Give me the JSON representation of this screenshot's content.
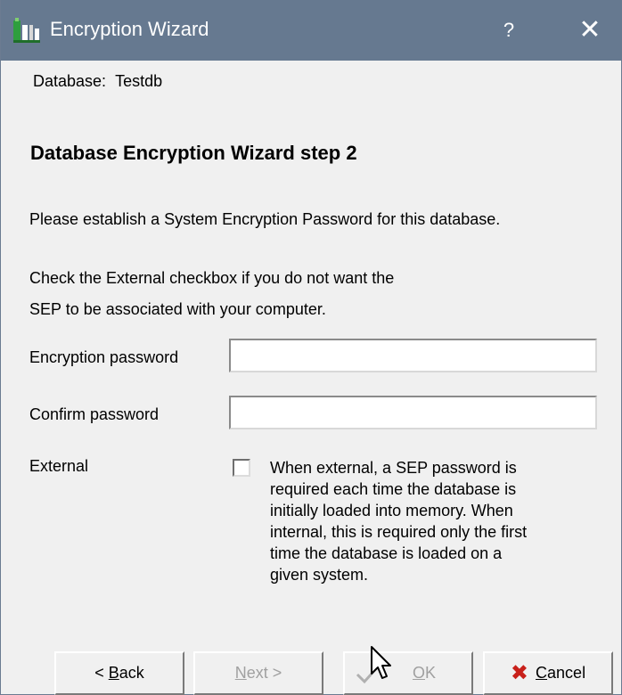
{
  "window": {
    "title": "Encryption Wizard",
    "help_label": "?",
    "close_label": "✕"
  },
  "database": {
    "label": "Database:",
    "value": "Testdb"
  },
  "step_title": "Database Encryption Wizard step 2",
  "instructions": {
    "line1": "Please establish a System Encryption Password for this database.",
    "line2": "Check the External checkbox if you do not want the",
    "line3": "SEP to be associated with your computer."
  },
  "form": {
    "encryption_password_label": "Encryption password",
    "encryption_password_value": "",
    "confirm_password_label": "Confirm password",
    "confirm_password_value": "",
    "external_label": "External",
    "external_checked": false,
    "external_description_lines": [
      "When external, a SEP password is",
      "required each time the database is",
      "initially loaded into memory.  When",
      "internal, this is required only the first",
      "time the database is loaded on a",
      "given system."
    ]
  },
  "buttons": {
    "back": {
      "prefix": "< ",
      "mnemonic": "B",
      "rest": "ack",
      "enabled": true
    },
    "next": {
      "mnemonic": "N",
      "rest": "ext >",
      "enabled": false
    },
    "ok": {
      "mnemonic": "O",
      "rest": "K",
      "enabled": false
    },
    "cancel": {
      "mnemonic": "C",
      "rest": "ancel",
      "enabled": true
    }
  },
  "colors": {
    "titlebar": "#667990",
    "cancel_icon": "#c8201a"
  }
}
